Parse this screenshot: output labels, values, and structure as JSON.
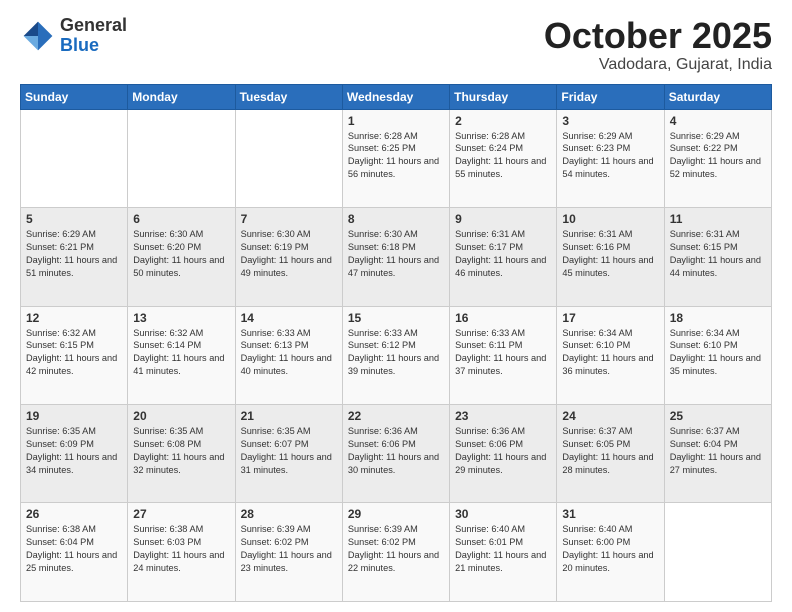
{
  "header": {
    "logo_general": "General",
    "logo_blue": "Blue",
    "month_title": "October 2025",
    "location": "Vadodara, Gujarat, India"
  },
  "days_of_week": [
    "Sunday",
    "Monday",
    "Tuesday",
    "Wednesday",
    "Thursday",
    "Friday",
    "Saturday"
  ],
  "weeks": [
    [
      {
        "day": "",
        "sunrise": "",
        "sunset": "",
        "daylight": ""
      },
      {
        "day": "",
        "sunrise": "",
        "sunset": "",
        "daylight": ""
      },
      {
        "day": "",
        "sunrise": "",
        "sunset": "",
        "daylight": ""
      },
      {
        "day": "1",
        "sunrise": "Sunrise: 6:28 AM",
        "sunset": "Sunset: 6:25 PM",
        "daylight": "Daylight: 11 hours and 56 minutes."
      },
      {
        "day": "2",
        "sunrise": "Sunrise: 6:28 AM",
        "sunset": "Sunset: 6:24 PM",
        "daylight": "Daylight: 11 hours and 55 minutes."
      },
      {
        "day": "3",
        "sunrise": "Sunrise: 6:29 AM",
        "sunset": "Sunset: 6:23 PM",
        "daylight": "Daylight: 11 hours and 54 minutes."
      },
      {
        "day": "4",
        "sunrise": "Sunrise: 6:29 AM",
        "sunset": "Sunset: 6:22 PM",
        "daylight": "Daylight: 11 hours and 52 minutes."
      }
    ],
    [
      {
        "day": "5",
        "sunrise": "Sunrise: 6:29 AM",
        "sunset": "Sunset: 6:21 PM",
        "daylight": "Daylight: 11 hours and 51 minutes."
      },
      {
        "day": "6",
        "sunrise": "Sunrise: 6:30 AM",
        "sunset": "Sunset: 6:20 PM",
        "daylight": "Daylight: 11 hours and 50 minutes."
      },
      {
        "day": "7",
        "sunrise": "Sunrise: 6:30 AM",
        "sunset": "Sunset: 6:19 PM",
        "daylight": "Daylight: 11 hours and 49 minutes."
      },
      {
        "day": "8",
        "sunrise": "Sunrise: 6:30 AM",
        "sunset": "Sunset: 6:18 PM",
        "daylight": "Daylight: 11 hours and 47 minutes."
      },
      {
        "day": "9",
        "sunrise": "Sunrise: 6:31 AM",
        "sunset": "Sunset: 6:17 PM",
        "daylight": "Daylight: 11 hours and 46 minutes."
      },
      {
        "day": "10",
        "sunrise": "Sunrise: 6:31 AM",
        "sunset": "Sunset: 6:16 PM",
        "daylight": "Daylight: 11 hours and 45 minutes."
      },
      {
        "day": "11",
        "sunrise": "Sunrise: 6:31 AM",
        "sunset": "Sunset: 6:15 PM",
        "daylight": "Daylight: 11 hours and 44 minutes."
      }
    ],
    [
      {
        "day": "12",
        "sunrise": "Sunrise: 6:32 AM",
        "sunset": "Sunset: 6:15 PM",
        "daylight": "Daylight: 11 hours and 42 minutes."
      },
      {
        "day": "13",
        "sunrise": "Sunrise: 6:32 AM",
        "sunset": "Sunset: 6:14 PM",
        "daylight": "Daylight: 11 hours and 41 minutes."
      },
      {
        "day": "14",
        "sunrise": "Sunrise: 6:33 AM",
        "sunset": "Sunset: 6:13 PM",
        "daylight": "Daylight: 11 hours and 40 minutes."
      },
      {
        "day": "15",
        "sunrise": "Sunrise: 6:33 AM",
        "sunset": "Sunset: 6:12 PM",
        "daylight": "Daylight: 11 hours and 39 minutes."
      },
      {
        "day": "16",
        "sunrise": "Sunrise: 6:33 AM",
        "sunset": "Sunset: 6:11 PM",
        "daylight": "Daylight: 11 hours and 37 minutes."
      },
      {
        "day": "17",
        "sunrise": "Sunrise: 6:34 AM",
        "sunset": "Sunset: 6:10 PM",
        "daylight": "Daylight: 11 hours and 36 minutes."
      },
      {
        "day": "18",
        "sunrise": "Sunrise: 6:34 AM",
        "sunset": "Sunset: 6:10 PM",
        "daylight": "Daylight: 11 hours and 35 minutes."
      }
    ],
    [
      {
        "day": "19",
        "sunrise": "Sunrise: 6:35 AM",
        "sunset": "Sunset: 6:09 PM",
        "daylight": "Daylight: 11 hours and 34 minutes."
      },
      {
        "day": "20",
        "sunrise": "Sunrise: 6:35 AM",
        "sunset": "Sunset: 6:08 PM",
        "daylight": "Daylight: 11 hours and 32 minutes."
      },
      {
        "day": "21",
        "sunrise": "Sunrise: 6:35 AM",
        "sunset": "Sunset: 6:07 PM",
        "daylight": "Daylight: 11 hours and 31 minutes."
      },
      {
        "day": "22",
        "sunrise": "Sunrise: 6:36 AM",
        "sunset": "Sunset: 6:06 PM",
        "daylight": "Daylight: 11 hours and 30 minutes."
      },
      {
        "day": "23",
        "sunrise": "Sunrise: 6:36 AM",
        "sunset": "Sunset: 6:06 PM",
        "daylight": "Daylight: 11 hours and 29 minutes."
      },
      {
        "day": "24",
        "sunrise": "Sunrise: 6:37 AM",
        "sunset": "Sunset: 6:05 PM",
        "daylight": "Daylight: 11 hours and 28 minutes."
      },
      {
        "day": "25",
        "sunrise": "Sunrise: 6:37 AM",
        "sunset": "Sunset: 6:04 PM",
        "daylight": "Daylight: 11 hours and 27 minutes."
      }
    ],
    [
      {
        "day": "26",
        "sunrise": "Sunrise: 6:38 AM",
        "sunset": "Sunset: 6:04 PM",
        "daylight": "Daylight: 11 hours and 25 minutes."
      },
      {
        "day": "27",
        "sunrise": "Sunrise: 6:38 AM",
        "sunset": "Sunset: 6:03 PM",
        "daylight": "Daylight: 11 hours and 24 minutes."
      },
      {
        "day": "28",
        "sunrise": "Sunrise: 6:39 AM",
        "sunset": "Sunset: 6:02 PM",
        "daylight": "Daylight: 11 hours and 23 minutes."
      },
      {
        "day": "29",
        "sunrise": "Sunrise: 6:39 AM",
        "sunset": "Sunset: 6:02 PM",
        "daylight": "Daylight: 11 hours and 22 minutes."
      },
      {
        "day": "30",
        "sunrise": "Sunrise: 6:40 AM",
        "sunset": "Sunset: 6:01 PM",
        "daylight": "Daylight: 11 hours and 21 minutes."
      },
      {
        "day": "31",
        "sunrise": "Sunrise: 6:40 AM",
        "sunset": "Sunset: 6:00 PM",
        "daylight": "Daylight: 11 hours and 20 minutes."
      },
      {
        "day": "",
        "sunrise": "",
        "sunset": "",
        "daylight": ""
      }
    ]
  ]
}
